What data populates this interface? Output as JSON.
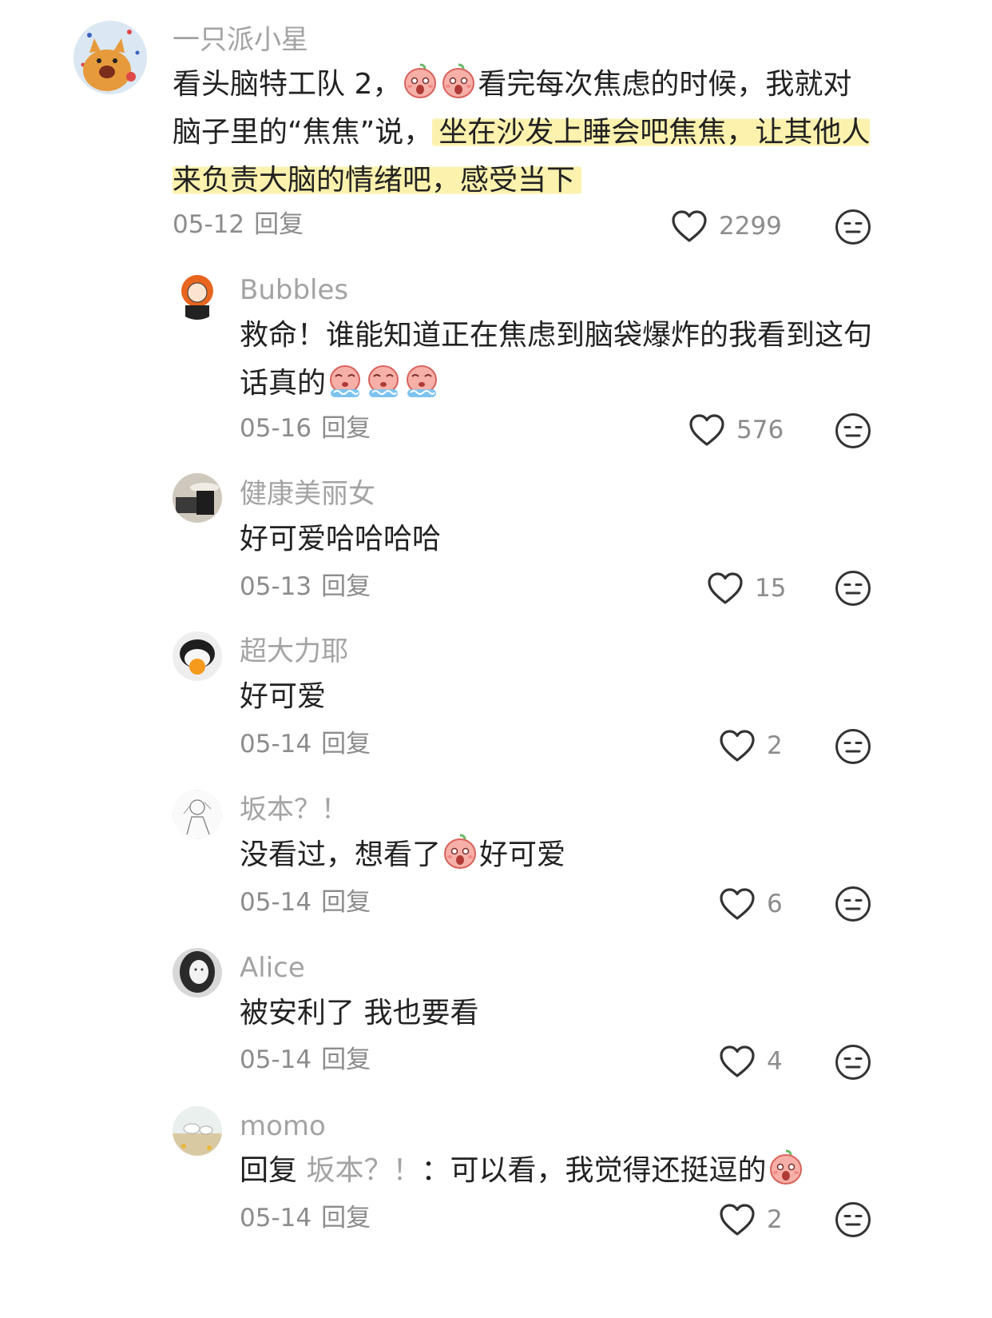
{
  "comments": [
    {
      "username": "一只派小星",
      "text_a": "看头脑特工队 2，",
      "text_b": "看完每次焦虑的时候，我就对脑子里的“焦焦”说，",
      "highlight": "坐在沙发上睡会吧焦焦，让其他人来负责大脑的情绪吧，感受当下",
      "date": "05-12",
      "reply_label": "回复",
      "likes": "2299",
      "avatar_icon": "orange-cat-avatar"
    },
    {
      "username": "Bubbles",
      "text": "救命！谁能知道正在焦虑到脑袋爆炸的我看到这句话真的",
      "date": "05-16",
      "reply_label": "回复",
      "likes": "576",
      "avatar_icon": "red-hair-girl-avatar"
    },
    {
      "username": "健康美丽女",
      "text": "好可爱哈哈哈哈",
      "date": "05-13",
      "reply_label": "回复",
      "likes": "15",
      "avatar_icon": "hat-photo-avatar"
    },
    {
      "username": "超大力耶",
      "text": "好可爱",
      "date": "05-14",
      "reply_label": "回复",
      "likes": "2",
      "avatar_icon": "bird-avatar"
    },
    {
      "username": "坂本？！",
      "text_a": "没看过，想看了",
      "text_b": "好可爱",
      "date": "05-14",
      "reply_label": "回复",
      "likes": "6",
      "avatar_icon": "sketch-avatar"
    },
    {
      "username": "Alice",
      "text": "被安利了 我也要看",
      "date": "05-14",
      "reply_label": "回复",
      "likes": "4",
      "avatar_icon": "bw-portrait-avatar"
    },
    {
      "username": "momo",
      "reply_prefix": "回复",
      "reply_to": "坂本？！",
      "text": "：可以看，我觉得还挺逗的",
      "date": "05-14",
      "reply_label": "回复",
      "likes": "2",
      "avatar_icon": "beach-avatar"
    }
  ],
  "colors": {
    "username": "#a3a3a3",
    "meta": "#8c8c8c",
    "highlight": "#fcf0a5",
    "emoji": "#f08a86"
  },
  "icons": [
    "heart-outline-icon",
    "neutral-face-icon",
    "anxiety-emoji"
  ]
}
